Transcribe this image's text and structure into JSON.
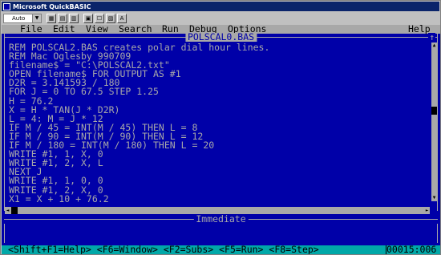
{
  "window": {
    "title": "Microsoft QuickBASIC"
  },
  "toolbar": {
    "font_value": "Auto",
    "font_arrow_icon": "chevron-down-icon",
    "buttons": [
      {
        "icon": "mark-icon",
        "glyph": "▦"
      },
      {
        "icon": "copy-icon",
        "glyph": "▤"
      },
      {
        "icon": "paste-icon",
        "glyph": "▥"
      },
      {
        "icon": "fullscreen-icon",
        "glyph": "▣"
      },
      {
        "icon": "properties-icon",
        "glyph": "☐"
      },
      {
        "icon": "background-icon",
        "glyph": "▧"
      },
      {
        "icon": "font-icon",
        "glyph": "A"
      }
    ]
  },
  "menu": {
    "items": [
      "File",
      "Edit",
      "View",
      "Search",
      "Run",
      "Debug",
      "Options"
    ],
    "help": "Help"
  },
  "editor": {
    "title": "POLSCAL0.BAS",
    "maximize_glyph": "↑",
    "lines": [
      "REM POLSCAL2.BAS creates polar dial hour lines.",
      "REM Mac Oglesby 990709",
      "filename$ = \"C:\\POLSCAL2.txt\"",
      "OPEN filename$ FOR OUTPUT AS #1",
      "D2R = 3.141593 / 180",
      "FOR J = 0 TO 67.5 STEP 1.25",
      "H = 76.2",
      "X = H * TAN(J * D2R)",
      "L = 4: M = J * 12",
      "IF M / 45 = INT(M / 45) THEN L = 8",
      "IF M / 90 = INT(M / 90) THEN L = 12",
      "IF M / 180 = INT(M / 180) THEN L = 20",
      "WRITE #1, 1, X, 0",
      "WRITE #1, 2, X, L",
      "NEXT J",
      "WRITE #1, 1, 0, 0",
      "WRITE #1, 2, X, 0",
      "X1 = X + 10 + 76.2"
    ]
  },
  "immediate": {
    "title": "Immediate"
  },
  "status": {
    "keys": "<Shift+F1=Help> <F6=Window> <F2=Subs> <F5=Run> <F8=Step>",
    "position": "00015:006"
  }
}
